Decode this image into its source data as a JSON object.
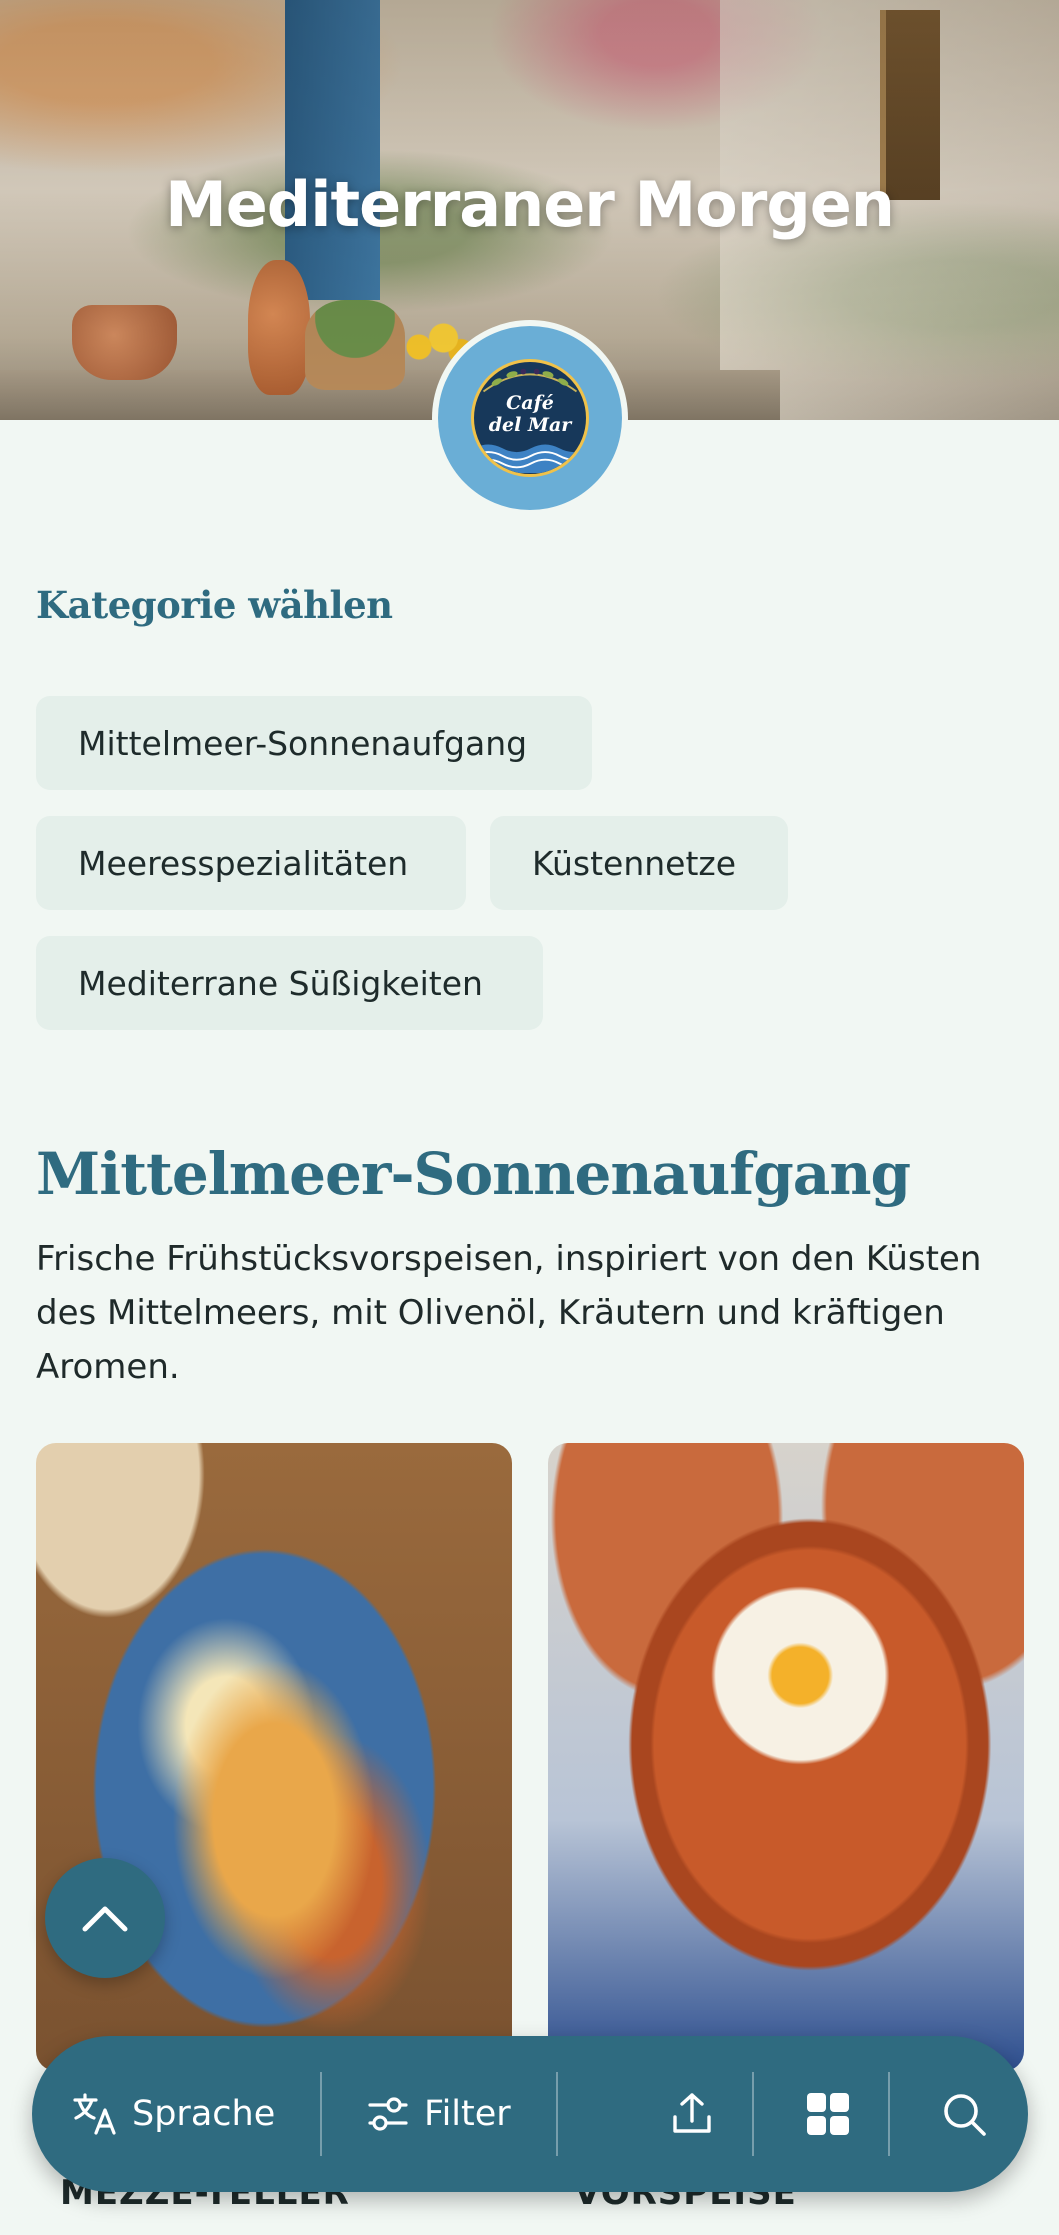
{
  "hero": {
    "title": "Mediterraner Morgen"
  },
  "logo": {
    "line1": "Café",
    "line2": "del Mar"
  },
  "categories": {
    "heading": "Kategorie wählen",
    "items": [
      {
        "label": "Mittelmeer-Sonnenaufgang"
      },
      {
        "label": "Meeresspezialitäten"
      },
      {
        "label": "Küstennetze"
      },
      {
        "label": "Mediterrane Süßigkeiten"
      }
    ]
  },
  "section": {
    "title": "Mittelmeer-Sonnenaufgang",
    "description": "Frische Frühstücksvorspeisen, inspiriert von den Küsten des Mittelmeers, mit Olivenöl, Kräutern und kräftigen Aromen."
  },
  "cards": [
    {
      "label": "MEZZE-TELLER",
      "image": "mezze-plate-photo"
    },
    {
      "label": "VORSPEISE",
      "image": "shakshuka-tagine-photo"
    }
  ],
  "bottom_bar": {
    "language_label": "Sprache",
    "filter_label": "Filter",
    "icons": [
      "translate-icon",
      "filter-icon",
      "share-icon",
      "grid-icon",
      "search-icon"
    ]
  },
  "colors": {
    "accent": "#2f6b80",
    "background": "#f1f7f3",
    "chip": "#e4efea"
  }
}
